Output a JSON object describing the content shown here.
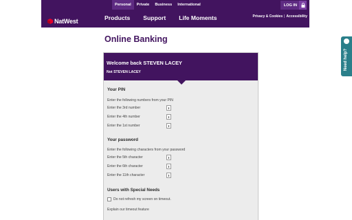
{
  "header": {
    "top_tabs": [
      "Personal",
      "Private",
      "Business",
      "International"
    ],
    "login_label": "LOG IN",
    "brand": "NatWest",
    "main_nav": [
      "Products",
      "Support",
      "Life Moments"
    ],
    "util_links": [
      "Privacy & Cookies",
      "Accessibility"
    ],
    "util_separator": "|"
  },
  "page": {
    "title": "Online Banking"
  },
  "panel": {
    "welcome": "Welcome back STEVEN LACEY",
    "not_user": "Not STEVEN LACEY"
  },
  "pin_section": {
    "title": "Your PIN",
    "intro": "Enter the following numbers from your PIN",
    "rows": [
      "Enter the 3rd number",
      "Enter the 4th number",
      "Enter the 1st number"
    ]
  },
  "password_section": {
    "title": "Your password",
    "intro": "Enter the following characters from your password",
    "rows": [
      "Enter the 5th character",
      "Enter the 6th character",
      "Enter the 11th character"
    ]
  },
  "special_needs": {
    "title": "Users with Special Needs",
    "checkbox_label": "Do not refresh my screen on timeout.",
    "explain_link": "Explain our timeout feature"
  },
  "help_tab": {
    "label": "Need help?"
  },
  "colors": {
    "brand_purple": "#42145f",
    "tab_active": "#5e2b82",
    "help_teal": "#2a7f8a",
    "panel_bg": "#ececec"
  }
}
